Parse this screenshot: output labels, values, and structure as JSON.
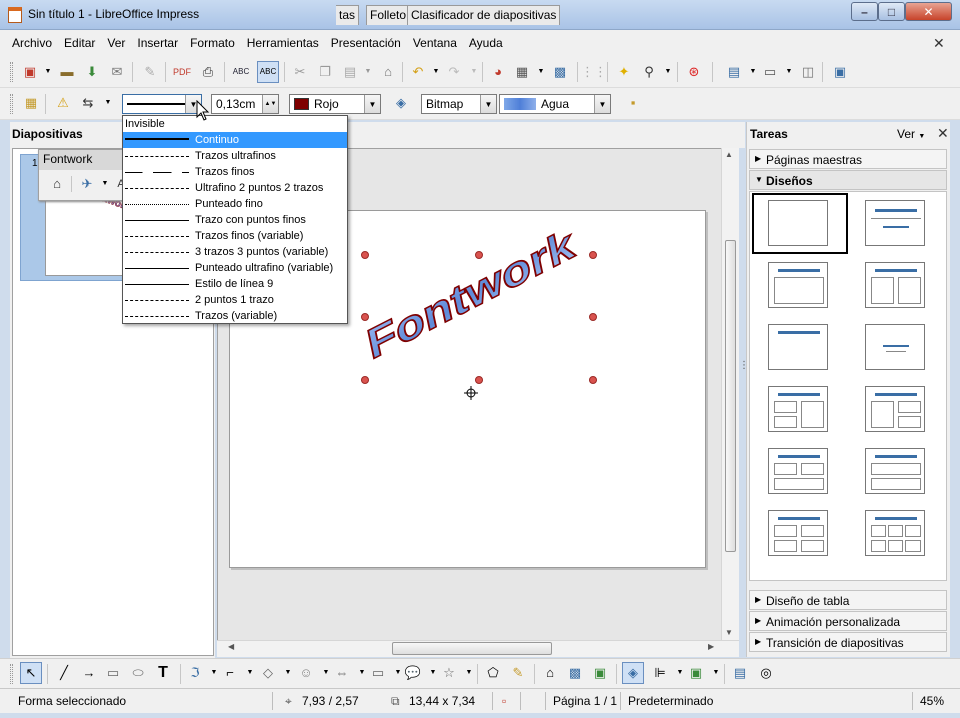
{
  "window": {
    "title": "Sin título 1 - LibreOffice Impress"
  },
  "menu": [
    "Archivo",
    "Editar",
    "Ver",
    "Insertar",
    "Formato",
    "Herramientas",
    "Presentación",
    "Ventana",
    "Ayuda"
  ],
  "toolbar2": {
    "line_width": "0,13cm",
    "line_color": "Rojo",
    "line_color_hex": "#7f0000",
    "fill_type": "Bitmap",
    "fill_value": "Agua"
  },
  "line_styles": {
    "items": [
      "Invisible",
      "Continuo",
      "Trazos ultrafinos",
      "Trazos finos",
      "Ultrafino 2 puntos 2 trazos",
      "Punteado fino",
      "Trazo con puntos finos",
      "Trazos finos (variable)",
      "3 trazos 3 puntos (variable)",
      "Punteado ultrafino (variable)",
      "Estilo de línea 9",
      "2 puntos 1 trazo",
      "Trazos (variable)"
    ],
    "selected": "Continuo"
  },
  "slides_panel": {
    "title": "Diapositivas",
    "thumb_number": "1"
  },
  "fontwork_toolbar": {
    "title": "Fontwork"
  },
  "view_tabs": [
    "tas",
    "Folleto",
    "Clasificador de diapositivas"
  ],
  "slide": {
    "fontwork_text": "Fontwork"
  },
  "tasks": {
    "title": "Tareas",
    "view_label": "Ver",
    "sections_top": [
      "Páginas maestras",
      "Diseños"
    ],
    "sections_bottom": [
      "Diseño de tabla",
      "Animación personalizada",
      "Transición de diapositivas"
    ]
  },
  "status": {
    "selection": "Forma seleccionado",
    "position": "7,93 / 2,57",
    "size": "13,44 x 7,34",
    "page": "Página 1 / 1",
    "master": "Predeterminado",
    "zoom": "45%"
  }
}
